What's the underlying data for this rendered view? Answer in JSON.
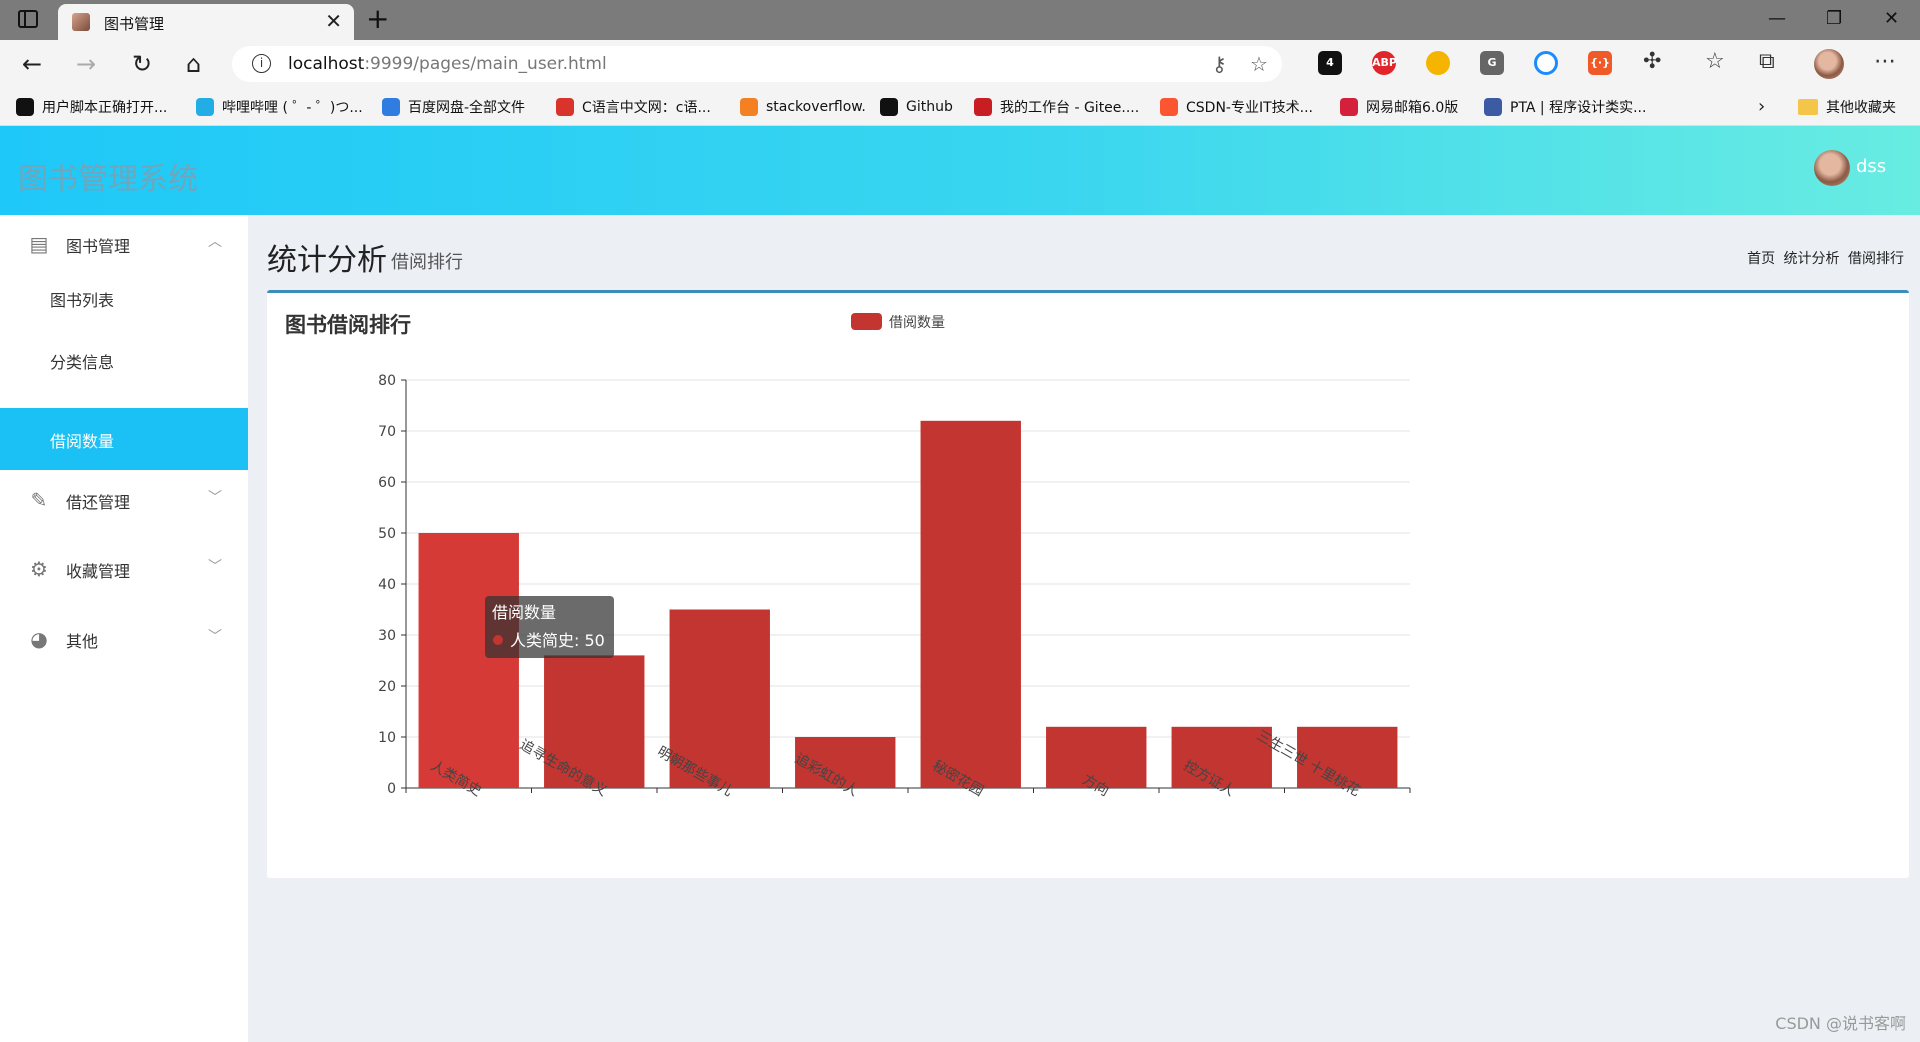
{
  "browser": {
    "tab_title": "图书管理",
    "url_host": "localhost",
    "url_rest": ":9999/pages/main_user.html",
    "extension_badge": "4",
    "bookmarks": [
      {
        "label": "用户脚本正确打开...",
        "icon_color": "#111111",
        "icon": "script-icon"
      },
      {
        "label": "哔哩哔哩 ( ゜- ゜)つ...",
        "icon_color": "#23ade5",
        "icon": "bilibili-icon"
      },
      {
        "label": "百度网盘-全部文件",
        "icon_color": "#2f7de1",
        "icon": "baidu-pan-icon"
      },
      {
        "label": "C语言中文网：c语...",
        "icon_color": "#d9342b",
        "icon": "c-icon"
      },
      {
        "label": "stackoverflow.",
        "icon_color": "#f48024",
        "icon": "stackoverflow-icon"
      },
      {
        "label": "Github",
        "icon_color": "#111111",
        "icon": "github-icon"
      },
      {
        "label": "我的工作台 - Gitee....",
        "icon_color": "#c71d23",
        "icon": "gitee-icon"
      },
      {
        "label": "CSDN-专业IT技术...",
        "icon_color": "#fc5531",
        "icon": "csdn-icon"
      },
      {
        "label": "网易邮箱6.0版",
        "icon_color": "#d4213b",
        "icon": "netease-mail-icon"
      },
      {
        "label": "PTA | 程序设计类实...",
        "icon_color": "#3b5ba5",
        "icon": "pta-icon"
      }
    ],
    "other_bookmarks": "其他收藏夹"
  },
  "app": {
    "title": "图书管理系统",
    "user_name": "dss"
  },
  "sidebar": {
    "groups": [
      {
        "label": "图书管理",
        "icon": "book-icon",
        "expanded": true,
        "items": [
          {
            "label": "图书列表",
            "active": false
          },
          {
            "label": "分类信息",
            "active": false
          },
          {
            "label": "借阅数量",
            "active": true
          }
        ]
      },
      {
        "label": "借还管理",
        "icon": "pencil-icon",
        "expanded": false
      },
      {
        "label": "收藏管理",
        "icon": "gear-icon",
        "expanded": false
      },
      {
        "label": "其他",
        "icon": "dashboard-icon",
        "expanded": false
      }
    ]
  },
  "page": {
    "title": "统计分析",
    "subtitle": "借阅排行",
    "breadcrumb": [
      "首页",
      "统计分析",
      "借阅排行"
    ]
  },
  "box": {
    "title": "图书借阅排行"
  },
  "chart_data": {
    "type": "bar",
    "title": "图书借阅排行",
    "categories": [
      "人类简史",
      "追寻生命的意义",
      "明朝那些事儿",
      "追彩虹的人",
      "秘密花园",
      "方向",
      "控方证人",
      "三生三世 十里桃花"
    ],
    "series": [
      {
        "name": "借阅数量",
        "values": [
          50,
          26,
          35,
          10,
          72,
          12,
          12,
          12
        ],
        "color": "#c23531"
      }
    ],
    "ylim": [
      0,
      80
    ],
    "yticks": [
      0,
      10,
      20,
      30,
      40,
      50,
      60,
      70,
      80
    ],
    "grid": true,
    "legend": "top-center",
    "tooltip": {
      "title": "借阅数量",
      "category": "人类简史",
      "value": 50
    }
  },
  "watermark": "CSDN @说书客啊"
}
